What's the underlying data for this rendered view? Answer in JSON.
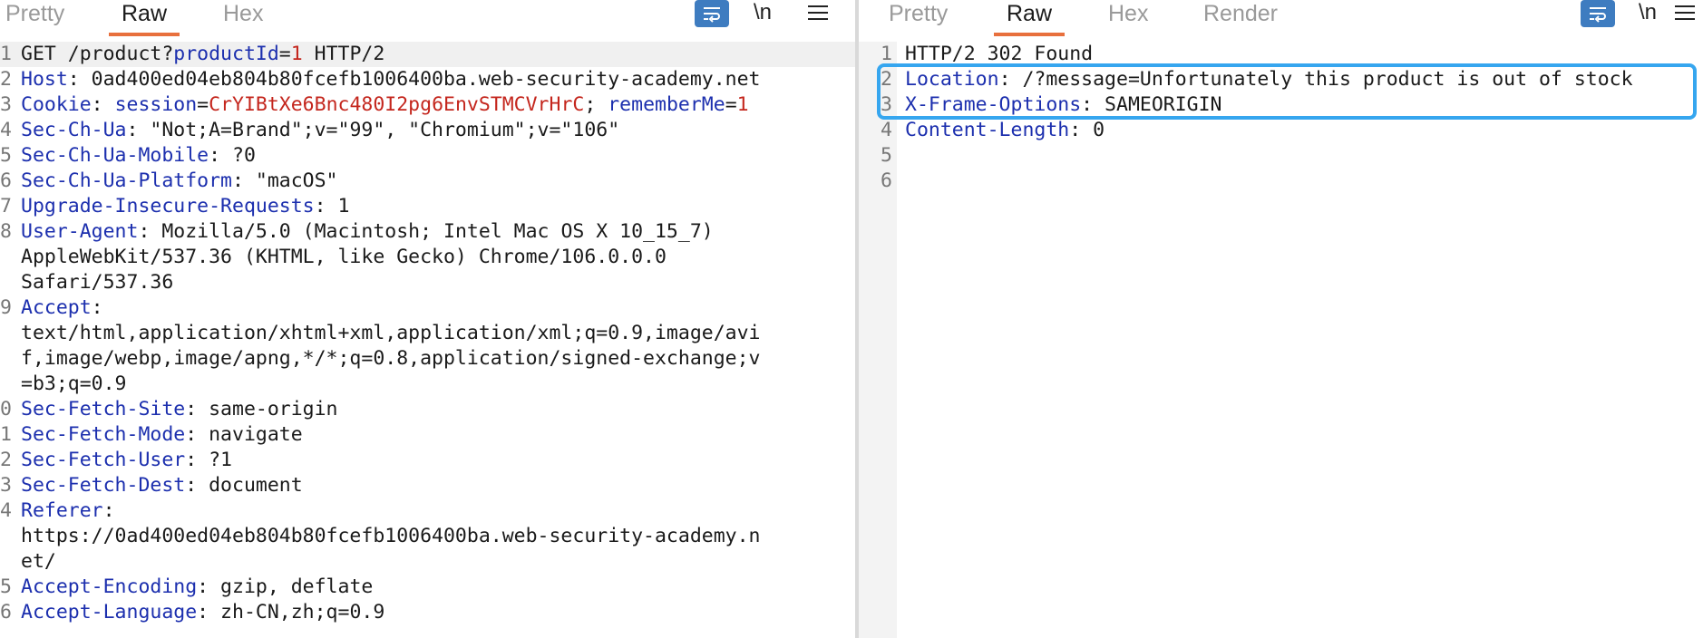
{
  "request": {
    "tabs": [
      {
        "label": "Pretty"
      },
      {
        "label": "Raw"
      },
      {
        "label": "Hex"
      }
    ],
    "newline_label": "\\n",
    "lines": [
      {
        "n": "1",
        "parts": [
          [
            "v",
            "GET /product?"
          ],
          [
            "k",
            "productId"
          ],
          [
            "v",
            "="
          ],
          [
            "r",
            "1"
          ],
          [
            "v",
            " HTTP/2"
          ]
        ]
      },
      {
        "n": "2",
        "parts": [
          [
            "k",
            "Host"
          ],
          [
            "v",
            ": 0ad400ed04eb804b80fcefb1006400ba.web-security-academy.net"
          ]
        ]
      },
      {
        "n": "3",
        "parts": [
          [
            "k",
            "Cookie"
          ],
          [
            "v",
            ": "
          ],
          [
            "k",
            "session"
          ],
          [
            "v",
            "="
          ],
          [
            "r",
            "CrYIBtXe6Bnc480I2pg6EnvSTMCVrHrC"
          ],
          [
            "v",
            "; "
          ],
          [
            "k",
            "rememberMe"
          ],
          [
            "v",
            "="
          ],
          [
            "r",
            "1"
          ]
        ]
      },
      {
        "n": "4",
        "parts": [
          [
            "k",
            "Sec-Ch-Ua"
          ],
          [
            "v",
            ": \"Not;A=Brand\";v=\"99\", \"Chromium\";v=\"106\""
          ]
        ]
      },
      {
        "n": "5",
        "parts": [
          [
            "k",
            "Sec-Ch-Ua-Mobile"
          ],
          [
            "v",
            ": ?0"
          ]
        ]
      },
      {
        "n": "6",
        "parts": [
          [
            "k",
            "Sec-Ch-Ua-Platform"
          ],
          [
            "v",
            ": \"macOS\""
          ]
        ]
      },
      {
        "n": "7",
        "parts": [
          [
            "k",
            "Upgrade-Insecure-Requests"
          ],
          [
            "v",
            ": 1"
          ]
        ]
      },
      {
        "n": "8",
        "parts": [
          [
            "k",
            "User-Agent"
          ],
          [
            "v",
            ": Mozilla/5.0 (Macintosh; Intel Mac OS X 10_15_7)"
          ]
        ]
      },
      {
        "n": "",
        "parts": [
          [
            "v",
            "AppleWebKit/537.36 (KHTML, like Gecko) Chrome/106.0.0.0"
          ]
        ]
      },
      {
        "n": "",
        "parts": [
          [
            "v",
            "Safari/537.36"
          ]
        ]
      },
      {
        "n": "9",
        "parts": [
          [
            "k",
            "Accept"
          ],
          [
            "v",
            ":"
          ]
        ]
      },
      {
        "n": "",
        "parts": [
          [
            "v",
            "text/html,application/xhtml+xml,application/xml;q=0.9,image/avi"
          ]
        ]
      },
      {
        "n": "",
        "parts": [
          [
            "v",
            "f,image/webp,image/apng,*/*;q=0.8,application/signed-exchange;v"
          ]
        ]
      },
      {
        "n": "",
        "parts": [
          [
            "v",
            "=b3;q=0.9"
          ]
        ]
      },
      {
        "n": "0",
        "parts": [
          [
            "k",
            "Sec-Fetch-Site"
          ],
          [
            "v",
            ": same-origin"
          ]
        ]
      },
      {
        "n": "1",
        "parts": [
          [
            "k",
            "Sec-Fetch-Mode"
          ],
          [
            "v",
            ": navigate"
          ]
        ]
      },
      {
        "n": "2",
        "parts": [
          [
            "k",
            "Sec-Fetch-User"
          ],
          [
            "v",
            ": ?1"
          ]
        ]
      },
      {
        "n": "3",
        "parts": [
          [
            "k",
            "Sec-Fetch-Dest"
          ],
          [
            "v",
            ": document"
          ]
        ]
      },
      {
        "n": "4",
        "parts": [
          [
            "k",
            "Referer"
          ],
          [
            "v",
            ":"
          ]
        ]
      },
      {
        "n": "",
        "parts": [
          [
            "v",
            "https://0ad400ed04eb804b80fcefb1006400ba.web-security-academy.n"
          ]
        ]
      },
      {
        "n": "",
        "parts": [
          [
            "v",
            "et/"
          ]
        ]
      },
      {
        "n": "5",
        "parts": [
          [
            "k",
            "Accept-Encoding"
          ],
          [
            "v",
            ": gzip, deflate"
          ]
        ]
      },
      {
        "n": "6",
        "parts": [
          [
            "k",
            "Accept-Language"
          ],
          [
            "v",
            ": zh-CN,zh;q=0.9"
          ]
        ]
      }
    ]
  },
  "response": {
    "tabs": [
      {
        "label": "Pretty"
      },
      {
        "label": "Raw"
      },
      {
        "label": "Hex"
      },
      {
        "label": "Render"
      }
    ],
    "newline_label": "\\n",
    "lines": [
      {
        "n": "1",
        "parts": [
          [
            "v",
            "HTTP/2 302 Found"
          ]
        ]
      },
      {
        "n": "2",
        "parts": [
          [
            "k",
            "Location"
          ],
          [
            "v",
            ": /?message=Unfortunately this product is out of stock"
          ]
        ]
      },
      {
        "n": "3",
        "parts": [
          [
            "k",
            "X-Frame-Options"
          ],
          [
            "v",
            ": SAMEORIGIN"
          ]
        ]
      },
      {
        "n": "4",
        "parts": [
          [
            "k",
            "Content-Length"
          ],
          [
            "v",
            ": 0"
          ]
        ]
      },
      {
        "n": "5",
        "parts": []
      },
      {
        "n": "6",
        "parts": []
      }
    ]
  },
  "colors": {
    "header_name": "#1c2fae",
    "param_value": "#c4261d",
    "active_tab_underline": "#e8703d",
    "highlight_box": "#36a6ef",
    "wrap_button": "#3e7cc0"
  },
  "icons": {
    "wrap": "wrap-lines-icon",
    "menu": "hamburger-menu-icon"
  }
}
